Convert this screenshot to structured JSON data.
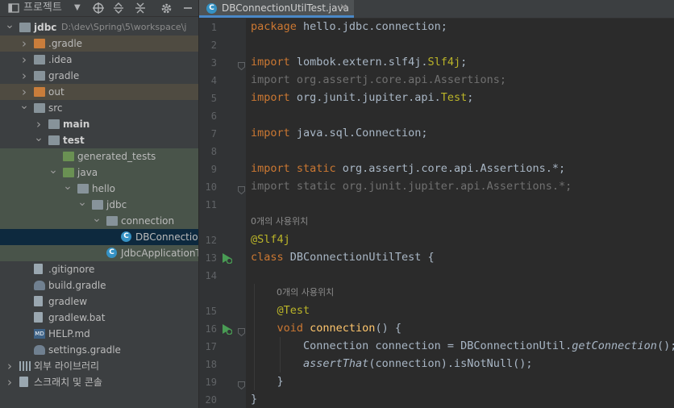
{
  "project_panel": {
    "title": "프로젝트",
    "tree": [
      {
        "id": "jdbc",
        "label": "jdbc",
        "detail": "D:\\dev\\Spring\\5\\workspace\\j",
        "depth": 0,
        "arrow": "open",
        "icon": "folder",
        "bold": true
      },
      {
        "id": "gradle-dir",
        "label": ".gradle",
        "depth": 1,
        "arrow": "closed",
        "icon": "folder-orange",
        "bg": "#4f4b41"
      },
      {
        "id": "idea-dir",
        "label": ".idea",
        "depth": 1,
        "arrow": "closed",
        "icon": "folder"
      },
      {
        "id": "gradle",
        "label": "gradle",
        "depth": 1,
        "arrow": "closed",
        "icon": "folder"
      },
      {
        "id": "out",
        "label": "out",
        "depth": 1,
        "arrow": "closed",
        "icon": "folder-orange",
        "bg": "#4f4b41"
      },
      {
        "id": "src",
        "label": "src",
        "depth": 1,
        "arrow": "open",
        "icon": "folder"
      },
      {
        "id": "main",
        "label": "main",
        "depth": 2,
        "arrow": "closed",
        "icon": "folder",
        "bold": true
      },
      {
        "id": "test",
        "label": "test",
        "depth": 2,
        "arrow": "open",
        "icon": "folder",
        "bold": true
      },
      {
        "id": "generated_tests",
        "label": "generated_tests",
        "depth": 3,
        "arrow": "none",
        "icon": "folder-gen",
        "bg": "#49544a"
      },
      {
        "id": "java",
        "label": "java",
        "depth": 3,
        "arrow": "open",
        "icon": "folder-gen",
        "bg": "#49544a"
      },
      {
        "id": "hello",
        "label": "hello",
        "depth": 4,
        "arrow": "open",
        "icon": "folder",
        "bg": "#49544a"
      },
      {
        "id": "jdbc-pkg",
        "label": "jdbc",
        "depth": 5,
        "arrow": "open",
        "icon": "folder",
        "bg": "#49544a"
      },
      {
        "id": "connection",
        "label": "connection",
        "depth": 6,
        "arrow": "open",
        "icon": "folder",
        "bg": "#49544a"
      },
      {
        "id": "DBConnectionUtilTest",
        "label": "DBConnectionUtilTest",
        "depth": 7,
        "arrow": "none",
        "icon": "class",
        "bg": "#0d293e",
        "selected": true
      },
      {
        "id": "JdbcApplicationTests",
        "label": "JdbcApplicationTests",
        "depth": 6,
        "arrow": "none",
        "icon": "class",
        "bg": "#49544a"
      },
      {
        "id": "gitignore",
        "label": ".gitignore",
        "depth": 1,
        "arrow": "none",
        "icon": "file"
      },
      {
        "id": "build-gradle",
        "label": "build.gradle",
        "depth": 1,
        "arrow": "none",
        "icon": "gradle"
      },
      {
        "id": "gradlew",
        "label": "gradlew",
        "depth": 1,
        "arrow": "none",
        "icon": "file"
      },
      {
        "id": "gradlew-bat",
        "label": "gradlew.bat",
        "depth": 1,
        "arrow": "none",
        "icon": "file"
      },
      {
        "id": "help-md",
        "label": "HELP.md",
        "depth": 1,
        "arrow": "none",
        "icon": "md"
      },
      {
        "id": "settings-gradle",
        "label": "settings.gradle",
        "depth": 1,
        "arrow": "none",
        "icon": "gradle"
      },
      {
        "id": "ext-libs",
        "label": "외부 라이브러리",
        "depth": 0,
        "arrow": "closed",
        "icon": "libs"
      },
      {
        "id": "scratches",
        "label": "스크래치 및 콘솔",
        "depth": 0,
        "arrow": "closed",
        "icon": "scratch"
      }
    ]
  },
  "editor": {
    "tab_label": "DBConnectionUtilTest.java",
    "hint": "0개의 사용위치",
    "lines": [
      {
        "n": "1",
        "parts": [
          [
            "kw",
            "package "
          ],
          [
            "",
            "hello.jdbc.connection;"
          ]
        ]
      },
      {
        "n": "2",
        "parts": []
      },
      {
        "n": "3",
        "fold": true,
        "parts": [
          [
            "kw",
            "import "
          ],
          [
            "",
            "lombok.extern.slf4j."
          ],
          [
            "ann",
            "Slf4j"
          ],
          [
            "",
            ";"
          ]
        ]
      },
      {
        "n": "4",
        "parts": [
          [
            "dim",
            "import org.assertj.core.api.Assertions;"
          ]
        ]
      },
      {
        "n": "5",
        "parts": [
          [
            "kw",
            "import "
          ],
          [
            "",
            "org.junit.jupiter.api."
          ],
          [
            "ann",
            "Test"
          ],
          [
            "",
            ";"
          ]
        ]
      },
      {
        "n": "6",
        "parts": []
      },
      {
        "n": "7",
        "parts": [
          [
            "kw",
            "import "
          ],
          [
            "",
            "java.sql.Connection;"
          ]
        ]
      },
      {
        "n": "8",
        "parts": []
      },
      {
        "n": "9",
        "parts": [
          [
            "kw",
            "import static "
          ],
          [
            "",
            "org.assertj.core.api.Assertions.*;"
          ]
        ]
      },
      {
        "n": "10",
        "fold": true,
        "parts": [
          [
            "dim",
            "import static org.junit.jupiter.api.Assertions.*;"
          ]
        ]
      },
      {
        "n": "11",
        "parts": []
      },
      {
        "n": "",
        "hint": true,
        "indent": 0
      },
      {
        "n": "12",
        "parts": [
          [
            "ann",
            "@Slf4j"
          ]
        ]
      },
      {
        "n": "13",
        "run": true,
        "parts": [
          [
            "kw",
            "class "
          ],
          [
            "",
            "DBConnectionUtilTest {"
          ]
        ]
      },
      {
        "n": "14",
        "parts": []
      },
      {
        "n": "",
        "hint": true,
        "indent": 4
      },
      {
        "n": "15",
        "parts": [
          [
            "",
            "    "
          ],
          [
            "ann",
            "@Test"
          ]
        ]
      },
      {
        "n": "16",
        "run": true,
        "fold": true,
        "parts": [
          [
            "",
            "    "
          ],
          [
            "kw",
            "void "
          ],
          [
            "fn",
            "connection"
          ],
          [
            "",
            "() {"
          ]
        ]
      },
      {
        "n": "17",
        "parts": [
          [
            "",
            "        Connection connection = DBConnectionUtil."
          ],
          [
            "it",
            "getConnection"
          ],
          [
            "",
            "();"
          ]
        ]
      },
      {
        "n": "18",
        "parts": [
          [
            "",
            "        "
          ],
          [
            "it",
            "assertThat"
          ],
          [
            "",
            "(connection).isNotNull();"
          ]
        ]
      },
      {
        "n": "19",
        "fold": true,
        "parts": [
          [
            "",
            "    }"
          ]
        ]
      },
      {
        "n": "20",
        "parts": [
          [
            "",
            "}"
          ]
        ]
      }
    ]
  }
}
